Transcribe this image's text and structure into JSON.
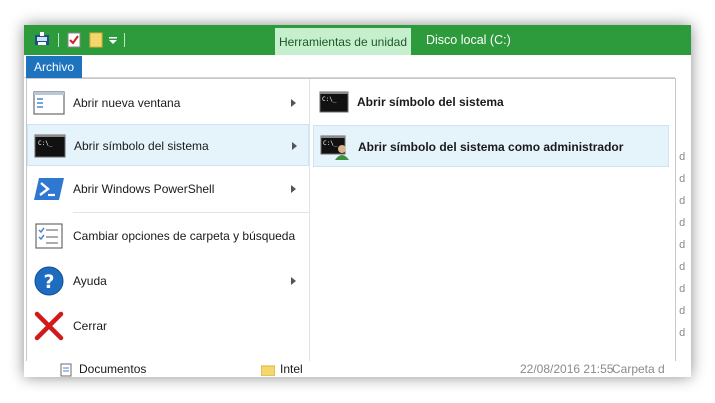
{
  "titlebar": {
    "tool_tab": "Herramientas de unidad",
    "window_title": "Disco local (C:)",
    "accent": "#2d9a3b"
  },
  "ribbon": {
    "file_tab": "Archivo",
    "file_tab_color": "#1e73be"
  },
  "menu": {
    "items": [
      {
        "label": "Abrir nueva ventana",
        "icon": "window-icon",
        "has_submenu": true
      },
      {
        "label": "Abrir símbolo del sistema",
        "icon": "cmd-icon",
        "has_submenu": true,
        "selected": true
      },
      {
        "label": "Abrir Windows PowerShell",
        "icon": "powershell-icon",
        "has_submenu": true
      },
      {
        "label": "Cambiar opciones de carpeta y búsqueda",
        "icon": "folder-options-icon",
        "has_submenu": false
      },
      {
        "label": "Ayuda",
        "icon": "help-icon",
        "has_submenu": true
      },
      {
        "label": "Cerrar",
        "icon": "close-icon",
        "has_submenu": false
      }
    ]
  },
  "submenu": {
    "items": [
      {
        "label": "Abrir símbolo del sistema",
        "icon": "cmd-icon"
      },
      {
        "label": "Abrir símbolo del sistema como administrador",
        "icon": "cmd-admin-icon",
        "selected": true
      }
    ]
  },
  "background": {
    "row_fragment": "a d",
    "footer": {
      "nav_item": "Documentos",
      "file_name": "Intel",
      "file_date": "22/08/2016 21:55",
      "file_type": "Carpeta d"
    }
  }
}
